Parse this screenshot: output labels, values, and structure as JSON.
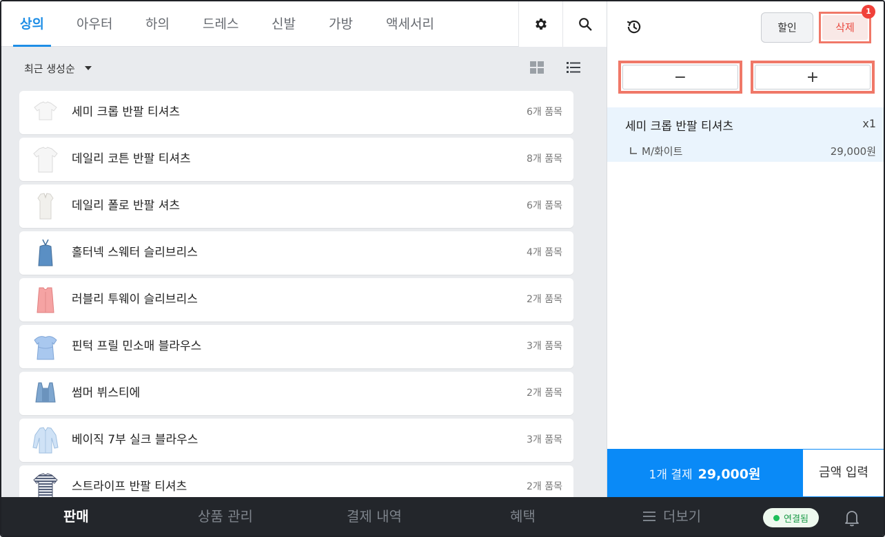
{
  "category_tabs": [
    {
      "label": "상의",
      "active": true
    },
    {
      "label": "아우터",
      "active": false
    },
    {
      "label": "하의",
      "active": false
    },
    {
      "label": "드레스",
      "active": false
    },
    {
      "label": "신발",
      "active": false
    },
    {
      "label": "가방",
      "active": false
    },
    {
      "label": "액세서리",
      "active": false
    }
  ],
  "toolbar": {
    "settings_icon": "gear-icon",
    "search_icon": "search-icon"
  },
  "sort": {
    "selected": "최근 생성순"
  },
  "view_toggle": {
    "grid_icon": "grid-view-icon",
    "list_icon": "list-view-icon",
    "active": "list"
  },
  "products": [
    {
      "name": "세미 크롭 반팔 티셔츠",
      "count": "6개 품목",
      "thumb": "white-tshirt"
    },
    {
      "name": "데일리 코튼 반팔 티셔츠",
      "count": "8개 품목",
      "thumb": "white-tshirt"
    },
    {
      "name": "데일리 폴로 반팔 셔츠",
      "count": "6개 품목",
      "thumb": "polo-shirt"
    },
    {
      "name": "홀터넥 스웨터 슬리브리스",
      "count": "4개 품목",
      "thumb": "blue-halter"
    },
    {
      "name": "러블리 투웨이 슬리브리스",
      "count": "2개 품목",
      "thumb": "pink-sleeveless"
    },
    {
      "name": "핀턱 프릴 민소매 블라우스",
      "count": "3개 품목",
      "thumb": "blue-blouse"
    },
    {
      "name": "썸머 뷔스티에",
      "count": "2개 품목",
      "thumb": "denim-bustier"
    },
    {
      "name": "베이직 7부 실크 블라우스",
      "count": "3개 품목",
      "thumb": "lightblue-blouse"
    },
    {
      "name": "스트라이프 반팔 티셔츠",
      "count": "2개 품목",
      "thumb": "striped-tshirt"
    }
  ],
  "cart": {
    "history_icon": "history-icon",
    "discount_label": "할인",
    "delete_label": "삭제",
    "delete_badge": "1",
    "minus_label": "−",
    "plus_label": "+",
    "item": {
      "name": "세미 크롭 반팔 티셔츠",
      "qty": "x1",
      "option": "M/화이트",
      "price": "29,000원"
    },
    "pay_count": "1개 결제",
    "pay_total": "29,000원",
    "amount_input_label": "금액 입력"
  },
  "bottom_nav": {
    "items": [
      {
        "label": "판매",
        "active": true
      },
      {
        "label": "상품 관리",
        "active": false
      },
      {
        "label": "결제 내역",
        "active": false
      },
      {
        "label": "혜택",
        "active": false
      },
      {
        "label": "더보기",
        "active": false
      }
    ],
    "status": "연결됨",
    "bell_icon": "bell-icon"
  },
  "colors": {
    "accent": "#1e8ee6",
    "pay_button": "#0a8af7",
    "highlight_border": "#f07868",
    "delete_text": "#e9473d",
    "connected": "#1cbf5a"
  }
}
